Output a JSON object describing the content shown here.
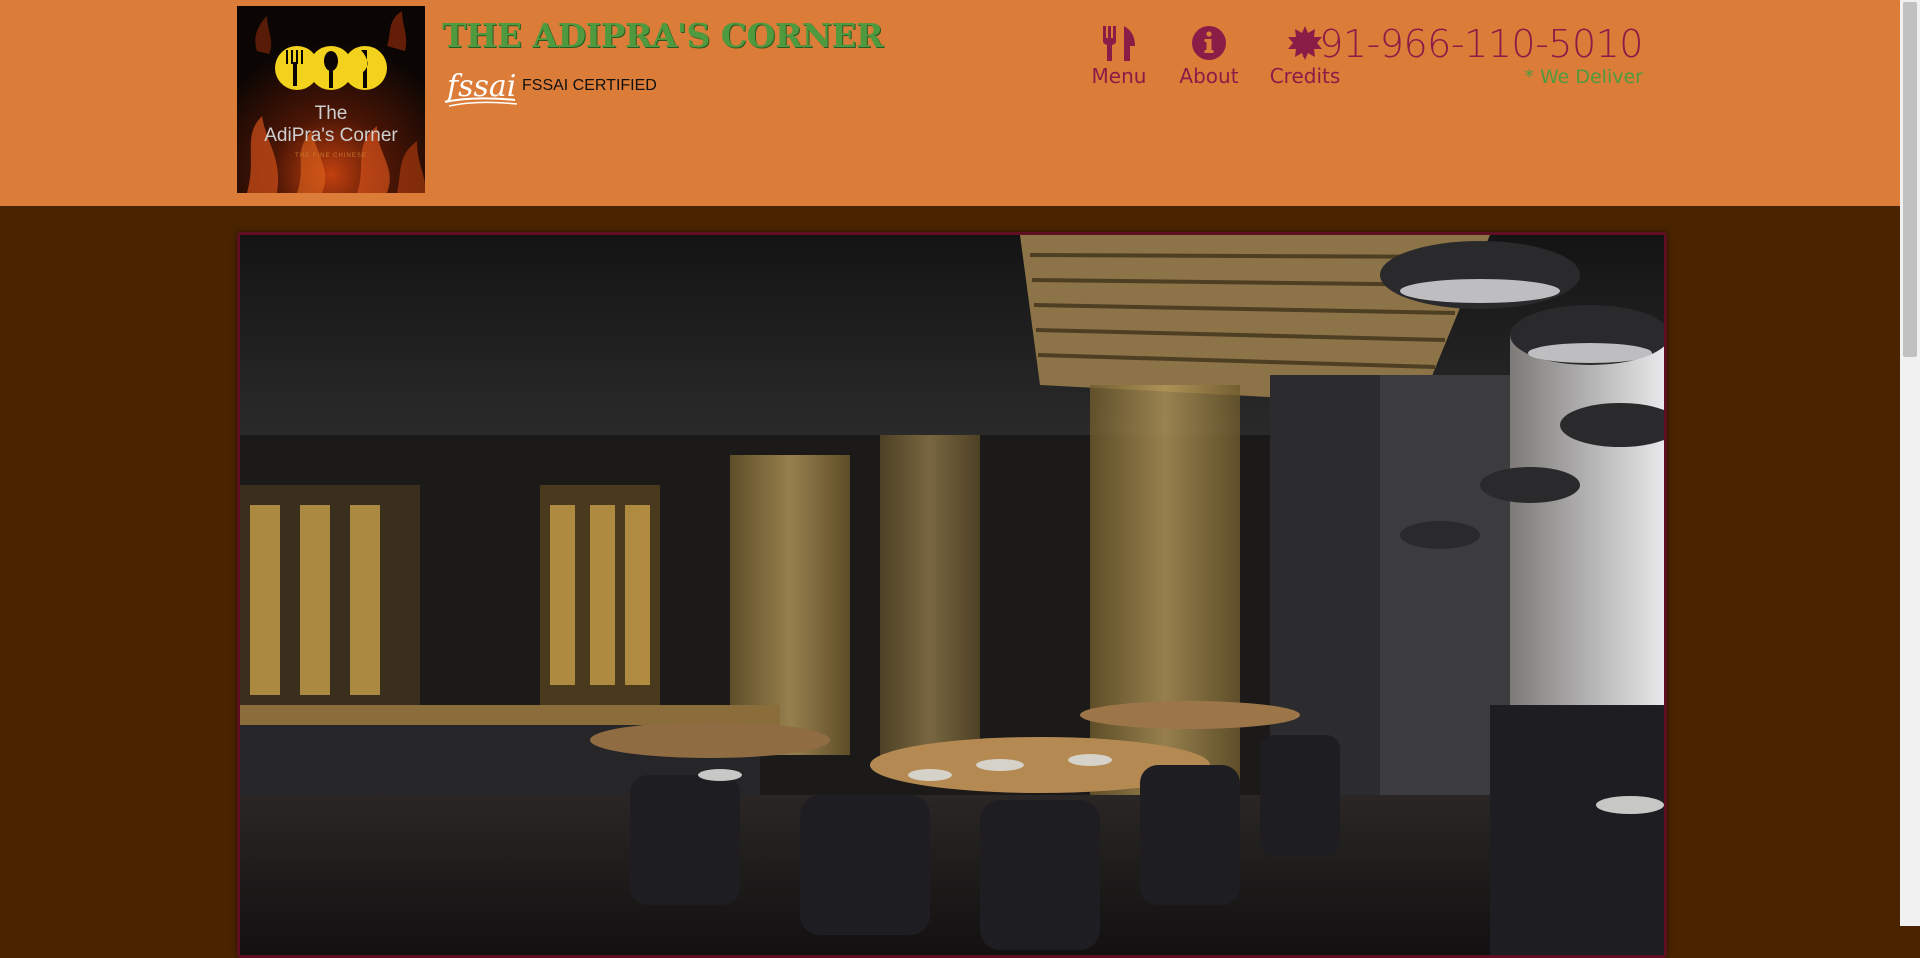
{
  "brand": {
    "logo_line1": "The",
    "logo_line2": "AdiPra's Corner",
    "logo_tagline": "THE FINE CHINESE",
    "title": "THE ADIPRA'S CORNER",
    "fssai_mark": "fssai",
    "certification": "FSSAI CERTIFIED"
  },
  "nav": {
    "items": [
      {
        "label": "Menu",
        "icon": "fork-knife-icon"
      },
      {
        "label": "About",
        "icon": "info-circle-icon"
      },
      {
        "label": "Credits",
        "icon": "certificate-icon"
      }
    ]
  },
  "contact": {
    "phone": "+91-966-110-5010",
    "delivery_note": "* We Deliver"
  },
  "colors": {
    "header_bg": "#db7c38",
    "page_bg": "#4a2300",
    "accent_maroon": "#8a1c48",
    "accent_green": "#4f9a3e"
  }
}
